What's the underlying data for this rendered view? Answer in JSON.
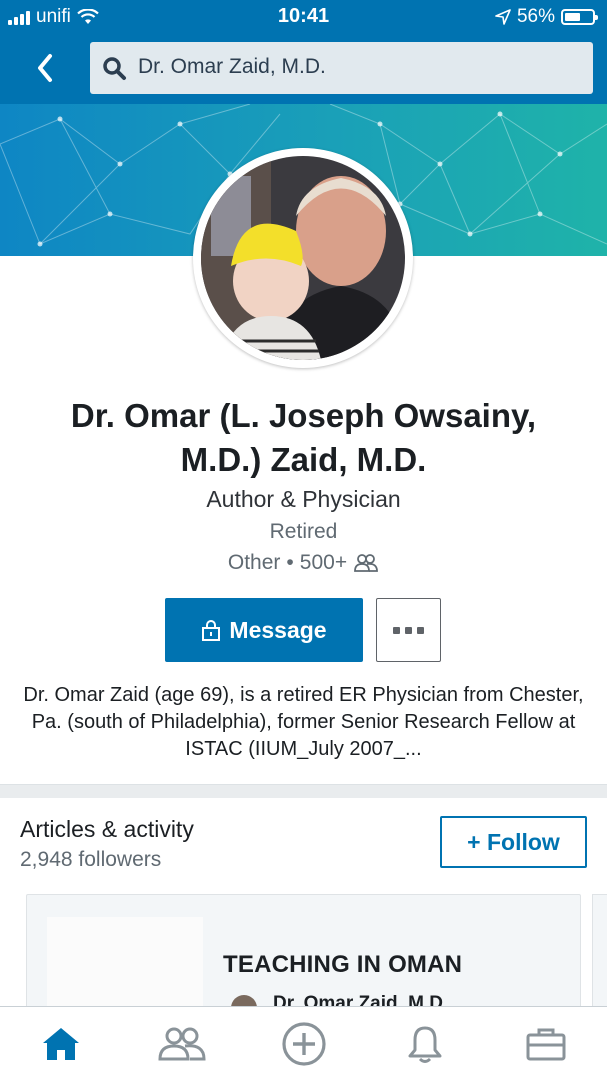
{
  "status_bar": {
    "carrier": "unifi",
    "time": "10:41",
    "battery": "56%",
    "battery_level": 0.56
  },
  "search": {
    "query": "Dr. Omar Zaid, M.D."
  },
  "profile": {
    "name": "Dr. Omar (L. Joseph Owsainy, M.D.) Zaid, M.D.",
    "headline": "Author & Physician",
    "status": "Retired",
    "location": "Other",
    "connections": "500+",
    "message_label": "Message",
    "summary": "Dr. Omar Zaid (age 69), is a retired ER Physician from Chester, Pa. (south of Philadelphia), former Senior Research Fellow at ISTAC (IIUM_July 2007_..."
  },
  "activity": {
    "title": "Articles & activity",
    "followers": "2,948 followers",
    "follow_label": "+ Follow",
    "article": {
      "title": "TEACHING IN OMAN",
      "author": "Dr. Omar Zaid, M.D."
    }
  },
  "tabs": [
    {
      "icon": "home-icon",
      "active": true
    },
    {
      "icon": "my-network-icon",
      "active": false
    },
    {
      "icon": "post-icon",
      "active": false
    },
    {
      "icon": "notifications-icon",
      "active": false
    },
    {
      "icon": "jobs-icon",
      "active": false
    }
  ],
  "colors": {
    "brand": "#0073b1",
    "tab_active": "#0073b1",
    "tab_inactive": "#8a9399"
  }
}
